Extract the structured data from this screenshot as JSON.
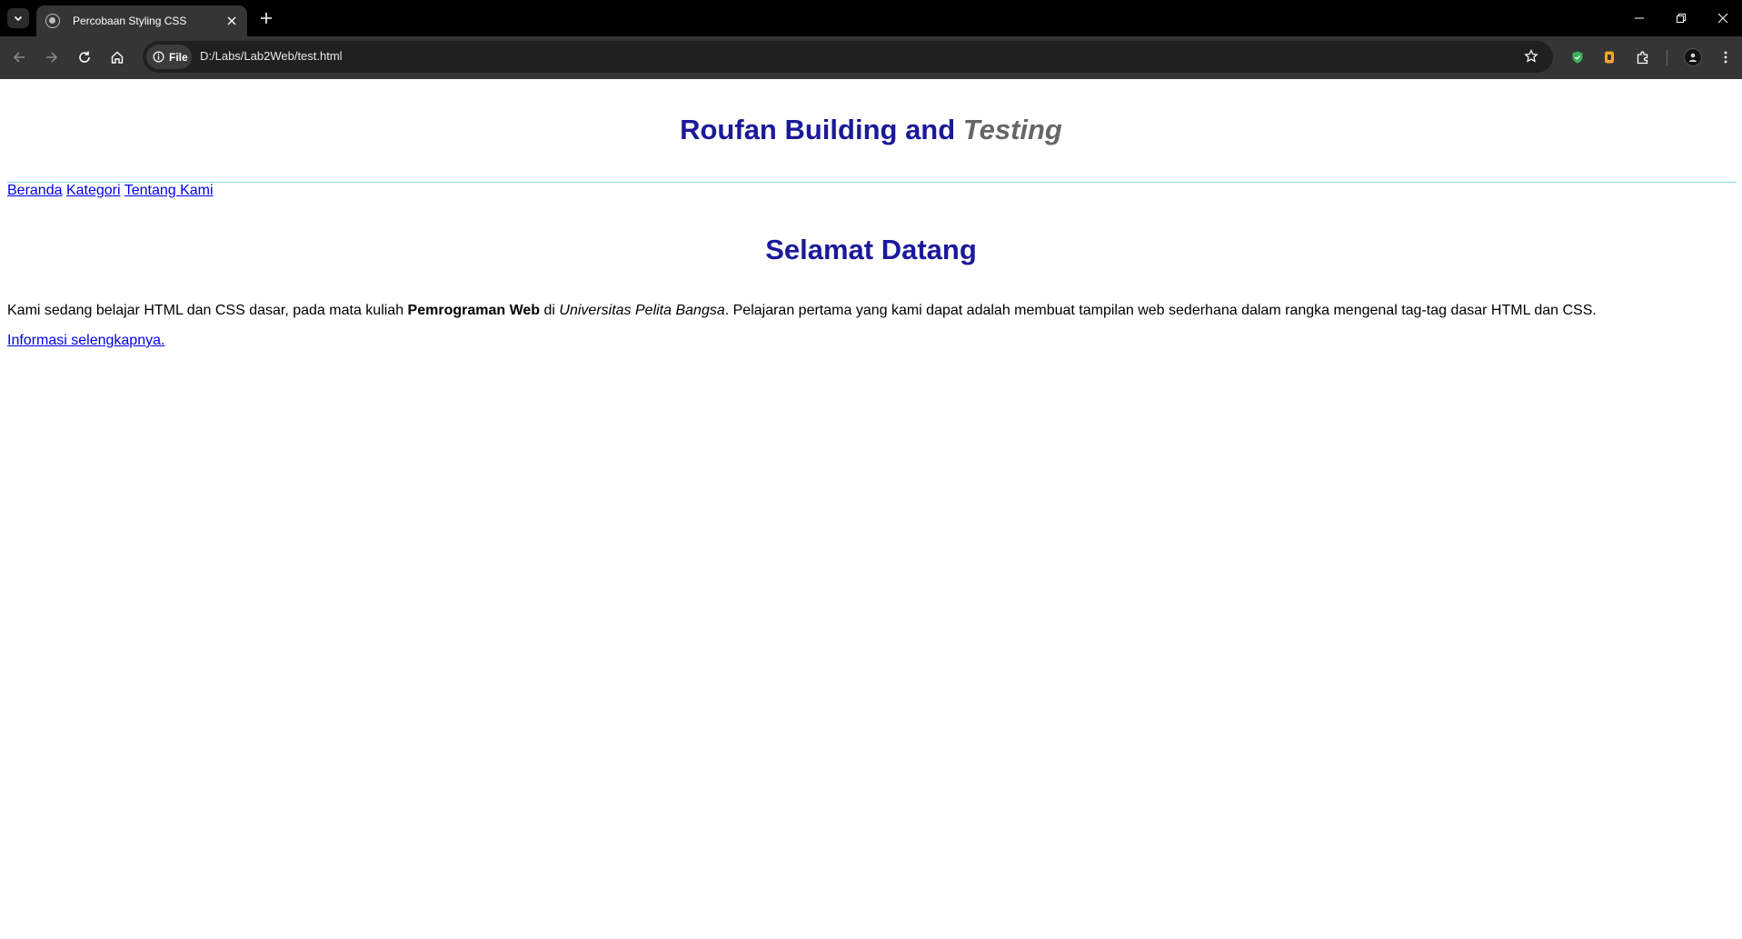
{
  "browser": {
    "tab": {
      "title": "Percobaan Styling CSS"
    },
    "omnibox": {
      "site_chip": "File",
      "url": "D:/Labs/Lab2Web/test.html"
    }
  },
  "page": {
    "header": {
      "title_main": "Roufan Building and ",
      "title_accent": "Testing"
    },
    "nav": {
      "links": [
        "Beranda",
        "Kategori",
        "Tentang Kami"
      ]
    },
    "welcome_heading": "Selamat Datang",
    "intro": {
      "part1": "Kami sedang belajar HTML dan CSS dasar, pada mata kuliah ",
      "bold": "Pemrograman Web",
      "part2": " di ",
      "italic": "Universitas Pelita Bangsa",
      "part3": ". Pelajaran pertama yang kami dapat adalah membuat tampilan web sederhana dalam rangka mengenal tag-tag dasar HTML dan CSS."
    },
    "more_link": "Informasi selengkapnya."
  },
  "colors": {
    "heading": "#1a1a99",
    "accent": "#666666",
    "link": "#0000ee",
    "rule": "#8fd3e8"
  }
}
